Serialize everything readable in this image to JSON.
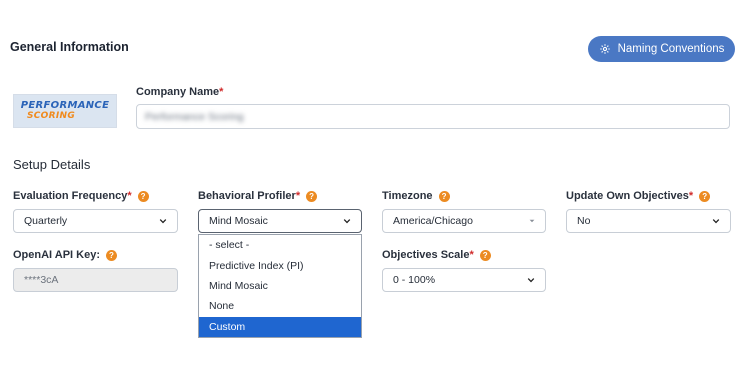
{
  "header": {
    "title": "General Information",
    "naming_button": "Naming Conventions",
    "naming_icon": "gear-icon"
  },
  "logo": {
    "line1": "PERFORMANCE",
    "line2": "SCORING"
  },
  "company": {
    "label": "Company Name",
    "required": "*",
    "value": "Performance Scoring"
  },
  "setup": {
    "title": "Setup Details",
    "evaluation_frequency": {
      "label": "Evaluation Frequency",
      "required": "*",
      "value": "Quarterly"
    },
    "behavioral_profiler": {
      "label": "Behavioral Profiler",
      "required": "*",
      "value": "Mind Mosaic",
      "options": [
        "- select -",
        "Predictive Index (PI)",
        "Mind Mosaic",
        "None",
        "Custom"
      ],
      "highlighted": "Custom"
    },
    "timezone": {
      "label": "Timezone",
      "value": "America/Chicago"
    },
    "update_own_objectives": {
      "label": "Update Own Objectives",
      "required": "*",
      "value": "No"
    },
    "openai_key": {
      "label": "OpenAI API Key:",
      "value": "****3cA"
    },
    "objectives_scale": {
      "label": "Objectives Scale",
      "required": "*",
      "value": "0 - 100%"
    }
  },
  "help_glyph": "?",
  "colors": {
    "accent": "#4a78c4",
    "help": "#ec8b22",
    "required": "#d02a2a",
    "highlight": "#1f66d0"
  }
}
